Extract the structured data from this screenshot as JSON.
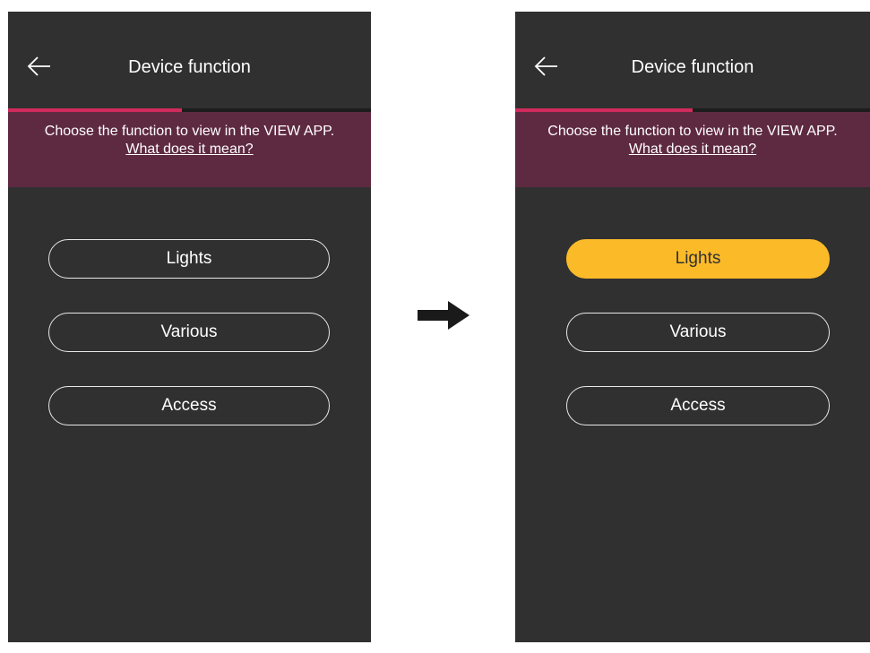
{
  "screens": [
    {
      "title": "Device function",
      "progress": 0.48,
      "info_text": "Choose the function to view in the VIEW APP.",
      "info_link": "What does it mean?",
      "options": [
        {
          "label": "Lights",
          "selected": false
        },
        {
          "label": "Various",
          "selected": false
        },
        {
          "label": "Access",
          "selected": false
        }
      ]
    },
    {
      "title": "Device function",
      "progress": 0.5,
      "info_text": "Choose the function to view in the VIEW APP.",
      "info_link": "What does it mean?",
      "options": [
        {
          "label": "Lights",
          "selected": true
        },
        {
          "label": "Various",
          "selected": false
        },
        {
          "label": "Access",
          "selected": false
        }
      ]
    }
  ],
  "transition_arrow": "right-arrow-icon",
  "colors": {
    "background": "#303030",
    "banner": "#5e2a41",
    "progress": "#d12a5c",
    "selected": "#fbbb29",
    "text": "#ffffff"
  }
}
